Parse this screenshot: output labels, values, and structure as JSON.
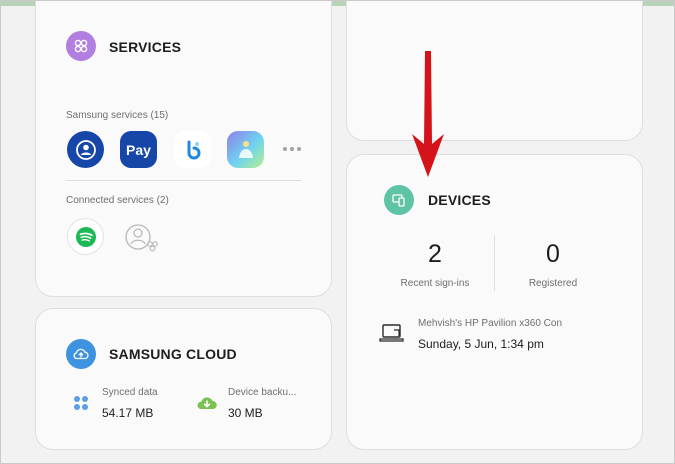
{
  "services": {
    "title": "SERVICES",
    "samsung_label": "Samsung services (15)",
    "connected_label": "Connected services (2)",
    "apps": [
      {
        "icon": "samsung-account-icon"
      },
      {
        "icon": "samsung-pay-icon",
        "label": "Pay"
      },
      {
        "icon": "bixby-icon"
      },
      {
        "icon": "galaxy-store-icon"
      }
    ],
    "connected": [
      {
        "icon": "spotify-icon"
      },
      {
        "icon": "add-connected-service-icon"
      }
    ]
  },
  "cloud": {
    "title": "SAMSUNG CLOUD",
    "synced_label": "Synced data",
    "synced_value": "54.17 MB",
    "backup_label": "Device backu...",
    "backup_value": "30 MB"
  },
  "devices": {
    "title": "DEVICES",
    "recent_count": "2",
    "recent_label": "Recent sign-ins",
    "registered_count": "0",
    "registered_label": "Registered",
    "device_name": "Mehvish's HP Pavilion x360 Con",
    "device_time": "Sunday, 5 Jun, 1:34 pm"
  },
  "colors": {
    "services_icon": "#b27fe0",
    "devices_icon": "#5fc3a5",
    "cloud_icon": "#3e93e0",
    "samsung_blue": "#1546a8",
    "arrow_red": "#d4141a",
    "spotify_green": "#1db954"
  }
}
